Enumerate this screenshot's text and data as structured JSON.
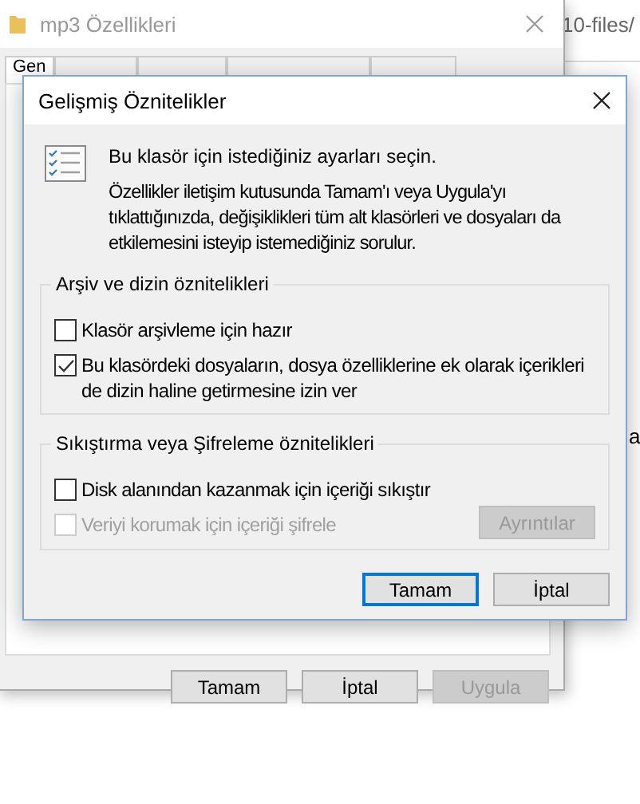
{
  "background_window": {
    "title": "mp3 Özellikleri",
    "tabs": [
      {
        "label": "Gen",
        "selected": true
      },
      {
        "selected": false
      },
      {
        "selected": false
      },
      {
        "selected": false
      },
      {
        "selected": false
      }
    ],
    "buttons": [
      {
        "label": "Tamam",
        "disabled": false
      },
      {
        "label": "İptal",
        "disabled": false
      },
      {
        "label": "Uygula",
        "disabled": true
      }
    ]
  },
  "explorer_behind": {
    "path": "10-files/",
    "fragment": "a"
  },
  "dialog": {
    "title": "Gelişmiş Öznitelikler",
    "intro": "Bu klasör için istediğiniz ayarları seçin.",
    "description": "Özellikler iletişim kutusunda Tamam'ı veya Uygula'yı tıklattığınızda, değişiklikleri tüm alt klasörleri ve dosyaları da etkilemesini isteyip istemediğiniz sorulur.",
    "groups": [
      {
        "title": "Arşiv ve dizin öznitelikleri",
        "options": [
          {
            "label": "Klasör arşivleme için hazır",
            "checked": false,
            "disabled": false
          },
          {
            "label": "Bu klasördeki dosyaların, dosya özelliklerine ek olarak içerikleri de dizin haline getirmesine izin ver",
            "checked": true,
            "disabled": false
          }
        ]
      },
      {
        "title": "Sıkıştırma veya Şifreleme öznitelikleri",
        "options": [
          {
            "label": "Disk alanından kazanmak için içeriği sıkıştır",
            "checked": false,
            "disabled": false
          },
          {
            "label": "Veriyi korumak için içeriği şifrele",
            "checked": false,
            "disabled": true,
            "button": {
              "label": "Ayrıntılar",
              "disabled": true
            }
          }
        ]
      }
    ],
    "buttons": [
      {
        "label": "Tamam",
        "default": true
      },
      {
        "label": "İptal",
        "default": false
      }
    ]
  }
}
